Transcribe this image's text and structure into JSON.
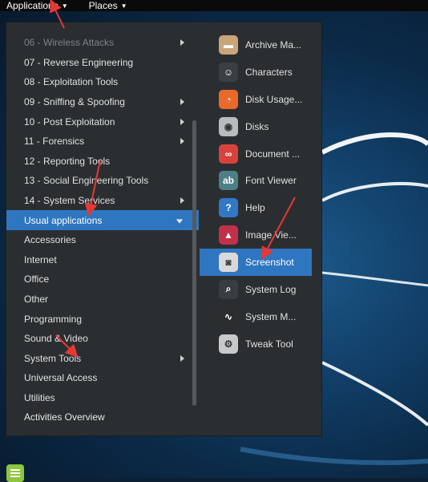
{
  "topbar": {
    "applications_label": "Applications",
    "places_label": "Places"
  },
  "categories": [
    {
      "label": "06 - Wireless Attacks",
      "has_submenu": true
    },
    {
      "label": "07 - Reverse Engineering",
      "has_submenu": false
    },
    {
      "label": "08 - Exploitation Tools",
      "has_submenu": false
    },
    {
      "label": "09 - Sniffing & Spoofing",
      "has_submenu": true
    },
    {
      "label": "10 - Post Exploitation",
      "has_submenu": true
    },
    {
      "label": "11 - Forensics",
      "has_submenu": true
    },
    {
      "label": "12 - Reporting Tools",
      "has_submenu": false
    },
    {
      "label": "13 - Social Engineering Tools",
      "has_submenu": false
    },
    {
      "label": "14 - System Services",
      "has_submenu": true
    },
    {
      "label": "Usual applications",
      "selected": true
    },
    {
      "label": "Accessories"
    },
    {
      "label": "Internet"
    },
    {
      "label": "Office"
    },
    {
      "label": "Other"
    },
    {
      "label": "Programming"
    },
    {
      "label": "Sound & Video"
    },
    {
      "label": "System Tools",
      "has_submenu": true
    },
    {
      "label": "Universal Access"
    },
    {
      "label": "Utilities"
    }
  ],
  "activities_overview": "Activities Overview",
  "apps": [
    {
      "label": "Archive Ma...",
      "icon": "archive-manager-icon",
      "color": "#c9a57a"
    },
    {
      "label": "Characters",
      "icon": "characters-icon",
      "color": "#3b3f44"
    },
    {
      "label": "Disk Usage...",
      "icon": "disk-usage-icon",
      "color": "#e8692a"
    },
    {
      "label": "Disks",
      "icon": "disks-icon",
      "color": "#b9bcbf"
    },
    {
      "label": "Document ...",
      "icon": "document-viewer-icon",
      "color": "#d8423b"
    },
    {
      "label": "Font Viewer",
      "icon": "font-viewer-icon",
      "color": "#4e7f86"
    },
    {
      "label": "Help",
      "icon": "help-icon",
      "color": "#3178c6"
    },
    {
      "label": "Image Vie...",
      "icon": "image-viewer-icon",
      "color": "#c2304a"
    },
    {
      "label": "Screenshot",
      "icon": "screenshot-icon",
      "color": "#d9d9d9",
      "selected": true
    },
    {
      "label": "System Log",
      "icon": "system-log-icon",
      "color": "#3a3d40"
    },
    {
      "label": "System M...",
      "icon": "system-monitor-icon",
      "color": "#2b2d2f"
    },
    {
      "label": "Tweak Tool",
      "icon": "tweak-tool-icon",
      "color": "#c7c9cb"
    }
  ],
  "colors": {
    "menu_bg": "#2b2e31",
    "selection": "#2f76c1",
    "annotation_arrow": "#e53935"
  }
}
